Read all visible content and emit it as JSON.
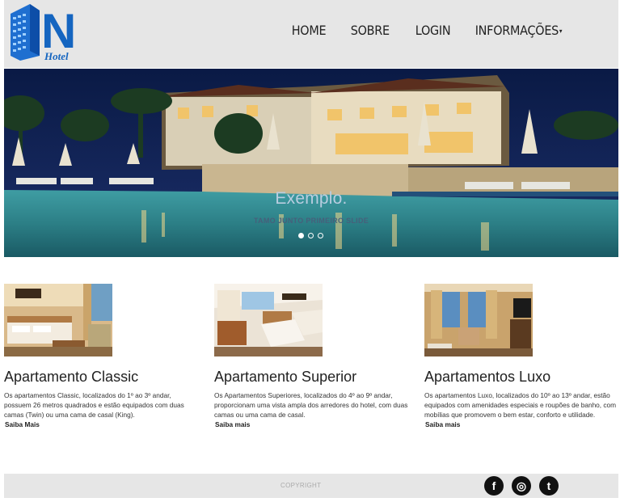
{
  "logo": {
    "letter": "N",
    "word": "Hotel"
  },
  "nav": {
    "items": [
      "HOME",
      "SOBRE",
      "LOGIN",
      "INFORMAÇÕES"
    ],
    "dropdown_icon": "caret-down-icon"
  },
  "slider": {
    "title": "Exemplo.",
    "subtitle": "TAMO JUNTO PRIMEIRO SLIDE",
    "slides": 3,
    "active_slide": 1
  },
  "rooms": [
    {
      "title": "Apartamento Classic",
      "description": "Os apartamentos Classic, localizados do 1º ao 3º andar, possuem 26 metros quadrados e estão equipados com duas camas (Twin) ou uma cama de casal (King).",
      "link": "Saiba Mais"
    },
    {
      "title": "Apartamento Superior",
      "description": "Os Apartamentos Superiores, localizados do 4º ao 9º andar, proporcionam uma vista ampla dos arredores do hotel, com duas camas ou uma cama de casal.",
      "link": "Saiba mais"
    },
    {
      "title": "Apartamentos Luxo",
      "description": "Os apartamentos Luxo, localizados do 10º ao 13º andar, estão equipados com amenidades especiais e roupões de banho, com mobílias que promovem o bem estar, conforto e utilidade.",
      "link": "Saiba mais"
    }
  ],
  "footer": {
    "copyright": "COPYRIGHT",
    "social": [
      {
        "name": "facebook-icon",
        "glyph": "f"
      },
      {
        "name": "instagram-icon",
        "glyph": "◎"
      },
      {
        "name": "twitter-icon",
        "glyph": "t"
      }
    ]
  },
  "colors": {
    "header_bg": "#e6e6e6",
    "logo_blue": "#1565c0",
    "night_sky": "#0b1a3f",
    "pool": "#2f8e94"
  }
}
